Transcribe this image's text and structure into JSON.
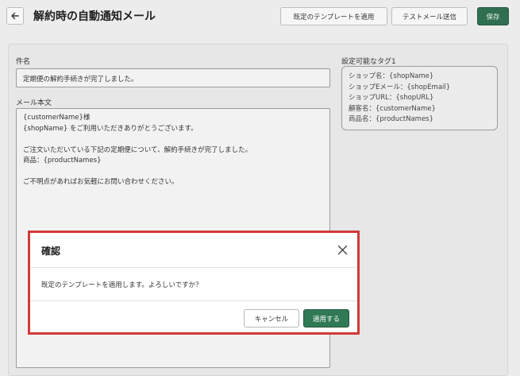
{
  "header": {
    "title": "解約時の自動通知メール",
    "apply_template_label": "既定のテンプレートを適用",
    "send_test_label": "テストメール送信",
    "save_label": "保存"
  },
  "form": {
    "subject_label": "件名",
    "subject_value": "定期便の解約手続きが完了しました。",
    "body_label": "メール本文",
    "body_lines": [
      "{customerName}様",
      "{shopName} をご利用いただきありがとうございます。",
      "",
      "ご注文いただいている下記の定期便について、解約手続きが完了しました。",
      "商品：{productNames}",
      "",
      "ご不明点があればお気軽にお問い合わせください。"
    ]
  },
  "tags": {
    "label": "設定可能なタグ1",
    "items": [
      "ショップ名：{shopName}",
      "ショップEメール：{shopEmail}",
      "ショップURL：{shopURL}",
      "顧客名：{customerName}",
      "商品名：{productNames}"
    ]
  },
  "modal": {
    "title": "確認",
    "message": "既定のテンプレートを適用します。よろしいですか？",
    "cancel_label": "キャンセル",
    "confirm_label": "適用する"
  },
  "colors": {
    "primary": "#2f7a55",
    "highlight_border": "#d23a3a"
  }
}
